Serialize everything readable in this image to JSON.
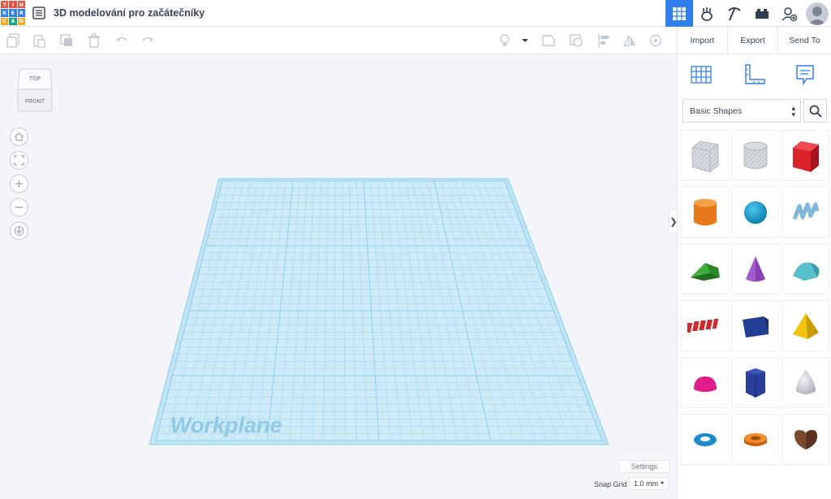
{
  "app": {
    "logo_letters": [
      "T",
      "I",
      "N",
      "K",
      "E",
      "R",
      "C",
      "A",
      "D"
    ],
    "logo_colors": [
      "#e8533f",
      "#e8533f",
      "#e8533f",
      "#2f80ed",
      "#2f80ed",
      "#2f80ed",
      "#f5a623",
      "#16a085",
      "#f5a623"
    ],
    "document_title": "3D modelování pro začátečníky"
  },
  "topbar": {
    "icons": [
      "grid-view-icon",
      "circuits-icon",
      "pickaxe-icon",
      "bricks-icon",
      "add-user-icon"
    ],
    "active": "grid-view-icon"
  },
  "toolbar": {
    "import_label": "Import",
    "export_label": "Export",
    "send_to_label": "Send To"
  },
  "viewcube": {
    "top_label": "TOP",
    "front_label": "FRONT"
  },
  "workplane": {
    "label": "Workplane",
    "color": "#9fd6ef"
  },
  "canvas": {
    "settings_label": "Settings",
    "snap_grid_label": "Snap Grid",
    "snap_grid_value": "1.0 mm"
  },
  "library": {
    "selected": "Basic Shapes",
    "shapes": [
      "box-hole",
      "cylinder-hole",
      "box",
      "cylinder",
      "sphere",
      "scribble",
      "roof",
      "cone",
      "round-roof",
      "text",
      "half-cylinder-wedge",
      "pyramid",
      "half-sphere",
      "polygon",
      "paraboloid",
      "torus",
      "tube",
      "heart"
    ]
  }
}
